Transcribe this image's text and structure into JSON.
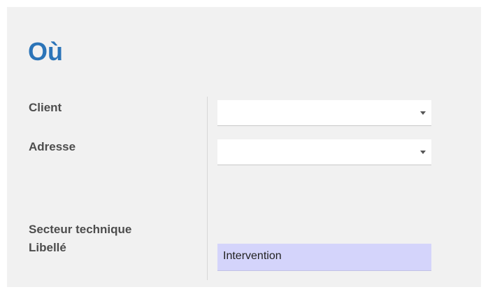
{
  "section": {
    "title": "Où"
  },
  "fields": {
    "client": {
      "label": "Client",
      "value": ""
    },
    "adresse": {
      "label": "Adresse",
      "value": ""
    },
    "secteur": {
      "label": "Secteur technique"
    },
    "libelle": {
      "label": "Libellé",
      "value": "Intervention"
    }
  },
  "icons": {
    "dropdown": "chevron-down-icon"
  },
  "colors": {
    "title": "#2b74b8",
    "panel_bg": "#f1f1f1",
    "highlight_input_bg": "#d4d4fb"
  }
}
